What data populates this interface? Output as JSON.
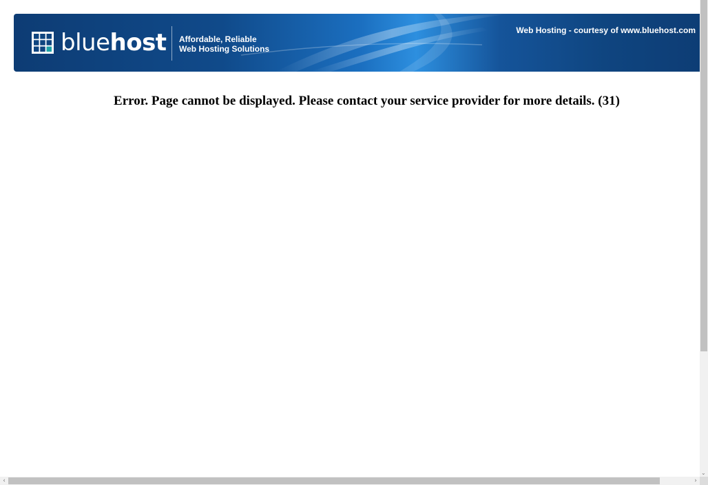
{
  "banner": {
    "brand_light": "blue",
    "brand_bold": "host",
    "tagline_line1": "Affordable, Reliable",
    "tagline_line2": "Web Hosting Solutions",
    "courtesy": "Web Hosting - courtesy of www.bluehost.com",
    "colors": {
      "dark": "#0d3c74",
      "mid": "#1b6fc0",
      "light": "#2d8fdf"
    }
  },
  "icons": {
    "logo": "grid-square-icon",
    "scroll_down": "chevron-down-icon",
    "scroll_left": "chevron-left-icon",
    "scroll_right": "chevron-right-icon"
  },
  "main": {
    "error_message": "Error. Page cannot be displayed. Please contact your service provider for more details. (31)"
  },
  "scrollbars": {
    "down_glyph": "⌄",
    "left_glyph": "‹",
    "right_glyph": "›"
  }
}
